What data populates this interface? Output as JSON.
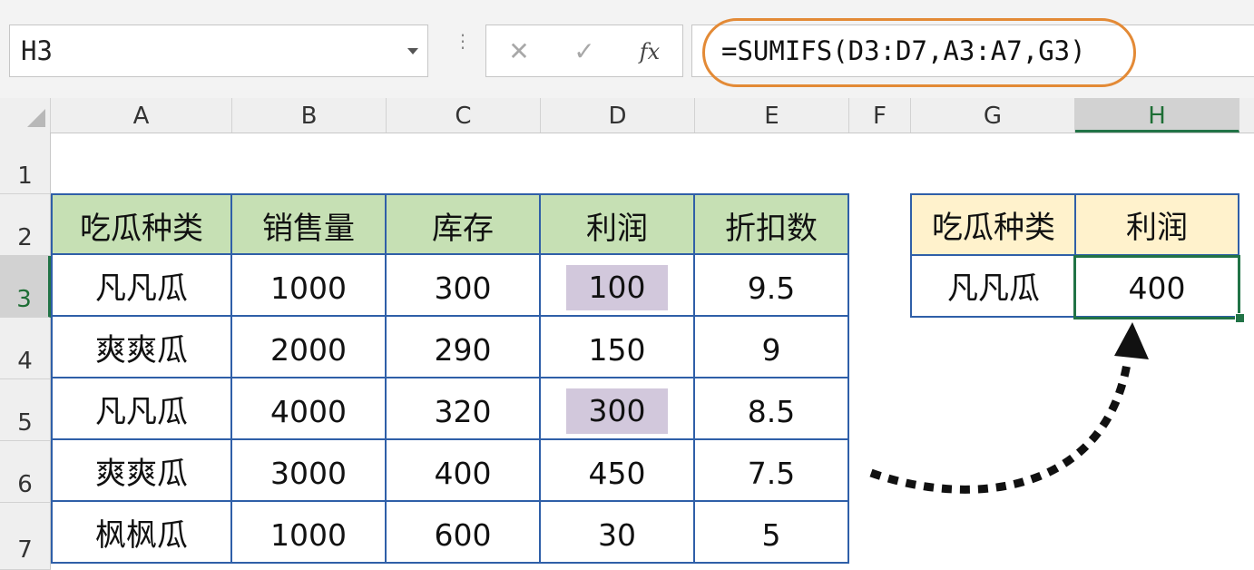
{
  "name_box": {
    "value": "H3"
  },
  "formula_bar": {
    "separator": "⋮",
    "cancel_glyph": "✕",
    "enter_glyph": "✓",
    "fx_label": "fx",
    "formula": "=SUMIFS(D3:D7,A3:A7,G3)"
  },
  "columns": [
    "A",
    "B",
    "C",
    "D",
    "E",
    "F",
    "G",
    "H"
  ],
  "rows": [
    "1",
    "2",
    "3",
    "4",
    "5",
    "6",
    "7"
  ],
  "selected_cell": {
    "column": "H",
    "row": "3"
  },
  "table": {
    "headers": [
      "吃瓜种类",
      "销售量",
      "库存",
      "利润",
      "折扣数"
    ],
    "rows": [
      [
        "凡凡瓜",
        "1000",
        "300",
        "100",
        "9.5"
      ],
      [
        "爽爽瓜",
        "2000",
        "290",
        "150",
        "9"
      ],
      [
        "凡凡瓜",
        "4000",
        "320",
        "300",
        "8.5"
      ],
      [
        "爽爽瓜",
        "3000",
        "400",
        "450",
        "7.5"
      ],
      [
        "枫枫瓜",
        "1000",
        "600",
        "30",
        "5"
      ]
    ],
    "highlighted_values": [
      "100",
      "300"
    ]
  },
  "lookup": {
    "headers": [
      "吃瓜种类",
      "利润"
    ],
    "criteria": "凡凡瓜",
    "result": "400"
  },
  "colors": {
    "table_header_bg": "#c6e0b4",
    "lookup_header_bg": "#fff2cc",
    "highlight_bg": "#d2c8dc",
    "border_blue": "#2f5fa8",
    "selection_green": "#217346",
    "formula_circle": "#e38a36"
  }
}
